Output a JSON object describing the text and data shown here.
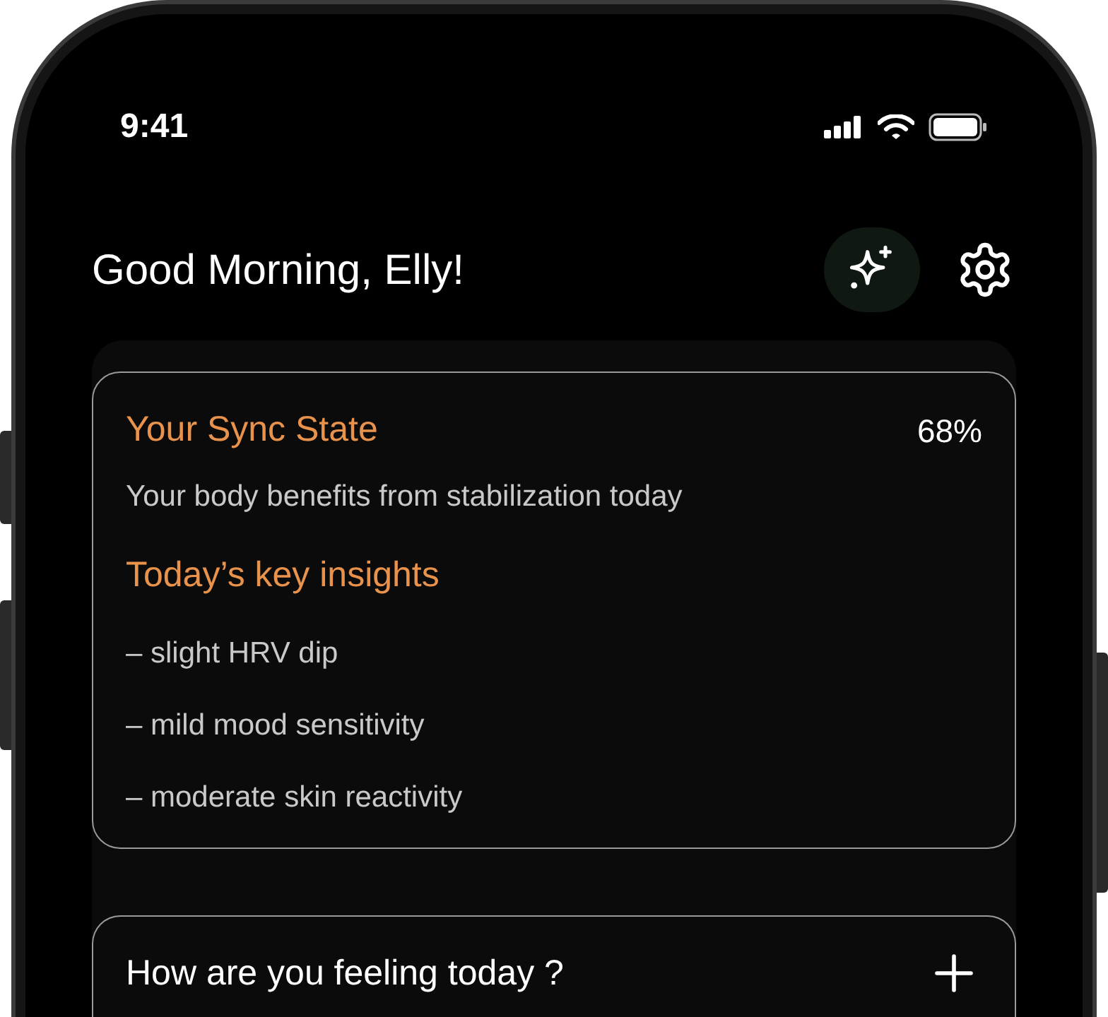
{
  "status_bar": {
    "time": "9:41"
  },
  "header": {
    "greeting": "Good Morning, Elly!"
  },
  "sync_card": {
    "title": "Your Sync State",
    "percent": "68%",
    "subtitle": "Your body benefits from stabilization today",
    "insights_title": "Today’s key insights",
    "insights": [
      "– slight HRV dip",
      "– mild mood sensitivity",
      "– moderate skin reactivity"
    ]
  },
  "feeling_card": {
    "question": "How are you feeling today ?"
  }
}
